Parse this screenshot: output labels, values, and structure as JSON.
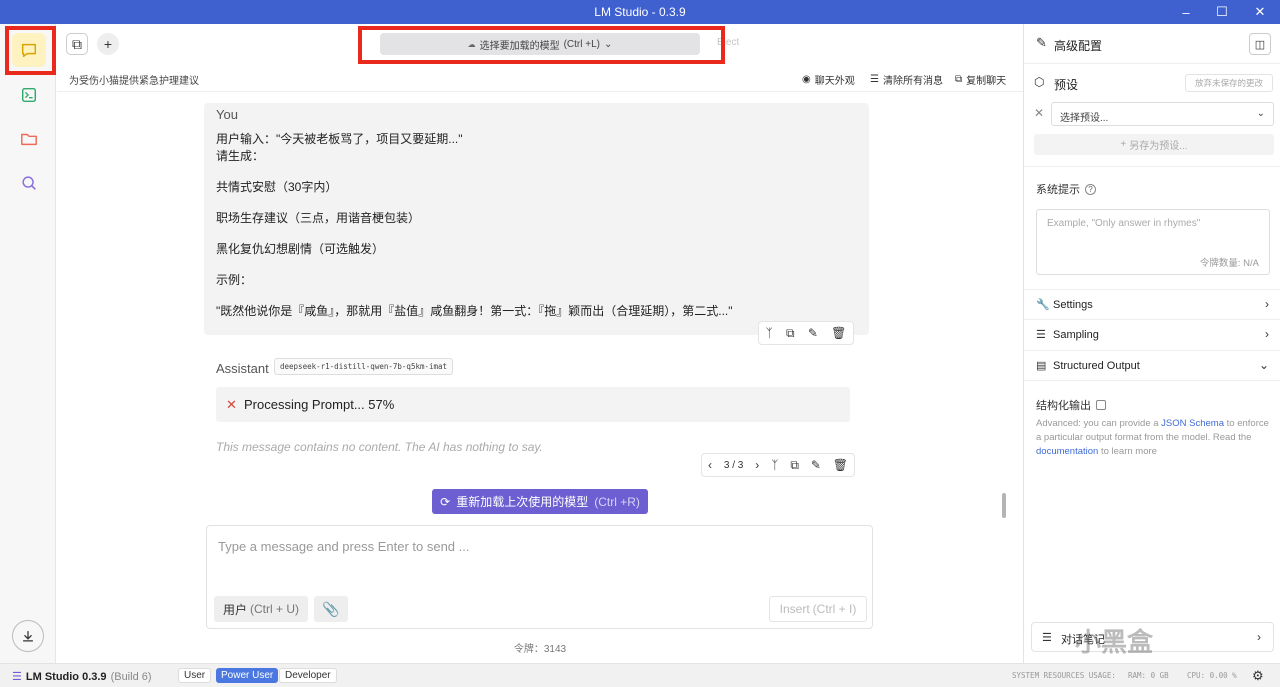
{
  "window": {
    "title": "LM Studio - 0.3.9"
  },
  "toolbar": {
    "model_select_label": "选择要加载的模型",
    "model_select_shortcut": "(Ctrl +L)",
    "eject_label": "Eject"
  },
  "chat": {
    "title": "为受伤小猫提供紧急护理建议",
    "actions": {
      "appearance": "聊天外观",
      "clear": "清除所有消息",
      "copy": "复制聊天"
    },
    "user_message": {
      "role": "You",
      "lines": [
        "用户输入：\"今天被老板骂了，项目又要延期...\"",
        "请生成：",
        "共情式安慰（30字内）",
        "职场生存建议（三点，用谐音梗包装）",
        "黑化复仇幻想剧情（可选触发）",
        "示例：",
        "\"既然他说你是『咸鱼』，那就用『盐值』咸鱼翻身！第一式：『拖』颖而出（合理延期），第二式...\""
      ]
    },
    "assistant": {
      "role": "Assistant",
      "model_tag": "deepseek-r1-distill-qwen-7b-q5km-imat",
      "processing": "Processing Prompt... 57%",
      "processing_progress": 0.57,
      "no_content": "This message contains no content. The AI has nothing to say.",
      "pager": "3 / 3"
    },
    "reload_button": "重新加载上次使用的模型",
    "reload_shortcut": "(Ctrl +R)",
    "composer": {
      "placeholder": "Type a message and press Enter to send ...",
      "role_label": "用户",
      "role_shortcut": "(Ctrl + U)",
      "insert_label": "Insert",
      "insert_shortcut": "(Ctrl + I)"
    },
    "token_count": "令牌：3143"
  },
  "right_panel": {
    "title": "高级配置",
    "preset_label": "预设",
    "discard_label": "放弃未保存的更改",
    "preset_select_placeholder": "选择预设...",
    "save_as_label": "另存为预设...",
    "system_prompt_label": "系统提示",
    "system_prompt_placeholder": "Example, \"Only answer in rhymes\"",
    "token_count": "令牌数量: N/A",
    "sections": {
      "settings": "Settings",
      "sampling": "Sampling",
      "structured_output": "Structured Output"
    },
    "structured_output_checkbox": "结构化输出",
    "structured_output_desc": {
      "before_link1": "Advanced: you can provide a ",
      "link1": "JSON Schema",
      "after_link1": " to enforce a particular output format from the model. Read the ",
      "link2": "documentation",
      "after_link2": " to learn more"
    },
    "notes_label": "对话笔记"
  },
  "status_bar": {
    "app_name": "LM Studio 0.3.9",
    "build": "(Build 6)",
    "modes": [
      "User",
      "Power User",
      "Developer"
    ],
    "active_mode": "Power User",
    "resources_label": "SYSTEM RESOURCES USAGE:",
    "ram": "RAM: 0 GB",
    "cpu": "CPU: 0.00 %"
  },
  "watermark": "小黑盒",
  "colors": {
    "titlebar": "#3f60cf",
    "accent": "#6d5fd1",
    "highlight_box": "#e8291c",
    "active_rail": "#fdf2c0"
  }
}
